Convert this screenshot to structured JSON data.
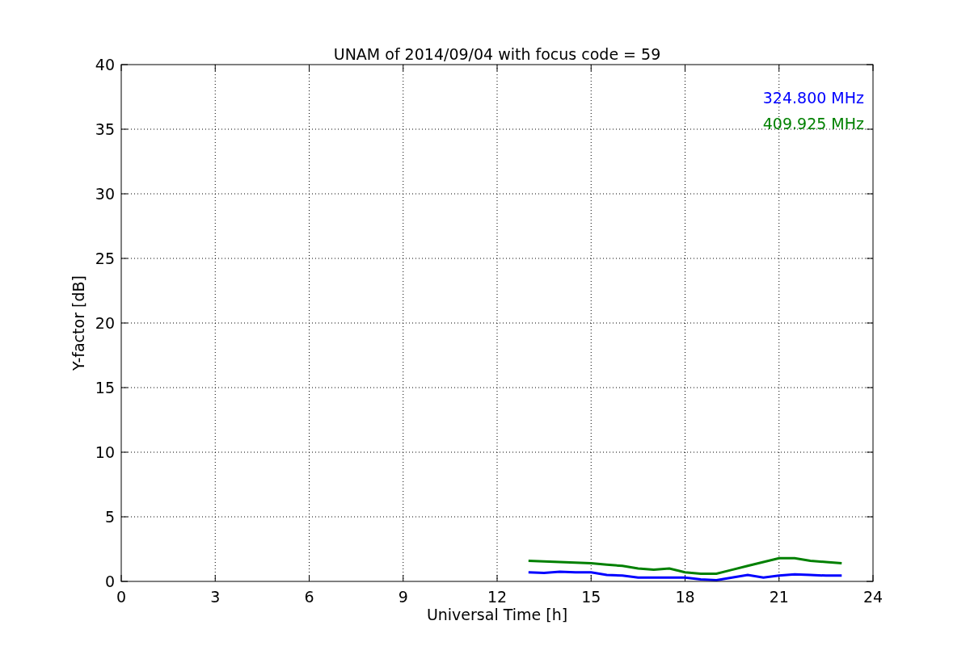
{
  "chart": {
    "chart_data": {
      "type": "line",
      "title": "UNAM of 2014/09/04 with focus code = 59",
      "xlabel": "Universal Time [h]",
      "ylabel": "Y-factor [dB]",
      "x": [
        13,
        13.5,
        14,
        14.5,
        15,
        15.5,
        16,
        16.5,
        17,
        17.5,
        18,
        18.5,
        19,
        19.5,
        20,
        20.5,
        21,
        21.5,
        22,
        22.5,
        23
      ],
      "series": [
        {
          "name": "324.800 MHz",
          "color": "#0000ff",
          "values": [
            0.7,
            0.65,
            0.75,
            0.7,
            0.7,
            0.5,
            0.45,
            0.3,
            0.3,
            0.3,
            0.3,
            0.15,
            0.1,
            0.3,
            0.5,
            0.3,
            0.45,
            0.55,
            0.5,
            0.45,
            0.45
          ]
        },
        {
          "name": "409.925 MHz",
          "color": "#008000",
          "values": [
            1.6,
            1.55,
            1.5,
            1.45,
            1.4,
            1.3,
            1.2,
            1.0,
            0.9,
            1.0,
            0.7,
            0.6,
            0.6,
            0.9,
            1.2,
            1.5,
            1.8,
            1.8,
            1.6,
            1.5,
            1.4
          ]
        }
      ],
      "grid": true,
      "xlim": [
        0,
        24
      ],
      "ylim": [
        0,
        40
      ],
      "xticks": [
        0,
        3,
        6,
        9,
        12,
        15,
        18,
        21,
        24
      ],
      "yticks": [
        0,
        5,
        10,
        15,
        20,
        25,
        30,
        35,
        40
      ]
    }
  }
}
